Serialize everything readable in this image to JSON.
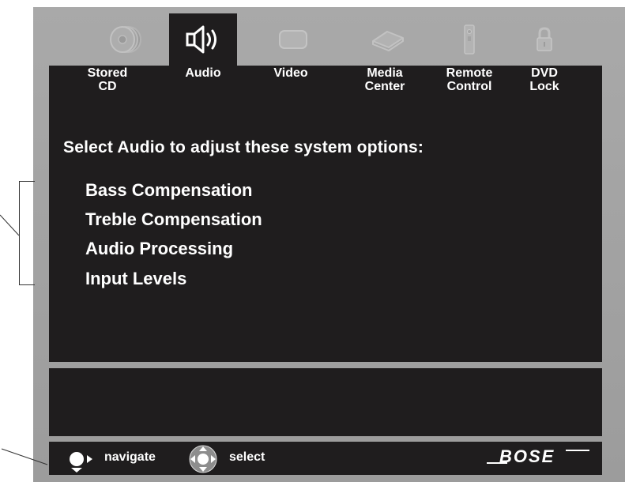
{
  "tabs": [
    {
      "label": "Stored\nCD",
      "icon": "cd-stack-icon",
      "active": false
    },
    {
      "label": "Audio",
      "icon": "speaker-icon",
      "active": true
    },
    {
      "label": "Video",
      "icon": "screen-icon",
      "active": false
    },
    {
      "label": "Media\nCenter",
      "icon": "media-center-icon",
      "active": false
    },
    {
      "label": "Remote\nControl",
      "icon": "remote-control-icon",
      "active": false
    },
    {
      "label": "DVD\nLock",
      "icon": "lock-icon",
      "active": false
    }
  ],
  "main": {
    "heading": "Select Audio to adjust these system options:",
    "options": [
      "Bass Compensation",
      "Treble Compensation",
      "Audio Processing",
      "Input Levels"
    ]
  },
  "footer": {
    "navigate_label": "navigate",
    "select_label": "select",
    "brand": "BOSE"
  },
  "colors": {
    "frame": "#a3a3a3",
    "panel": "#1f1d1e",
    "text": "#ffffff",
    "inactive_icon": "#b9b9b9"
  }
}
